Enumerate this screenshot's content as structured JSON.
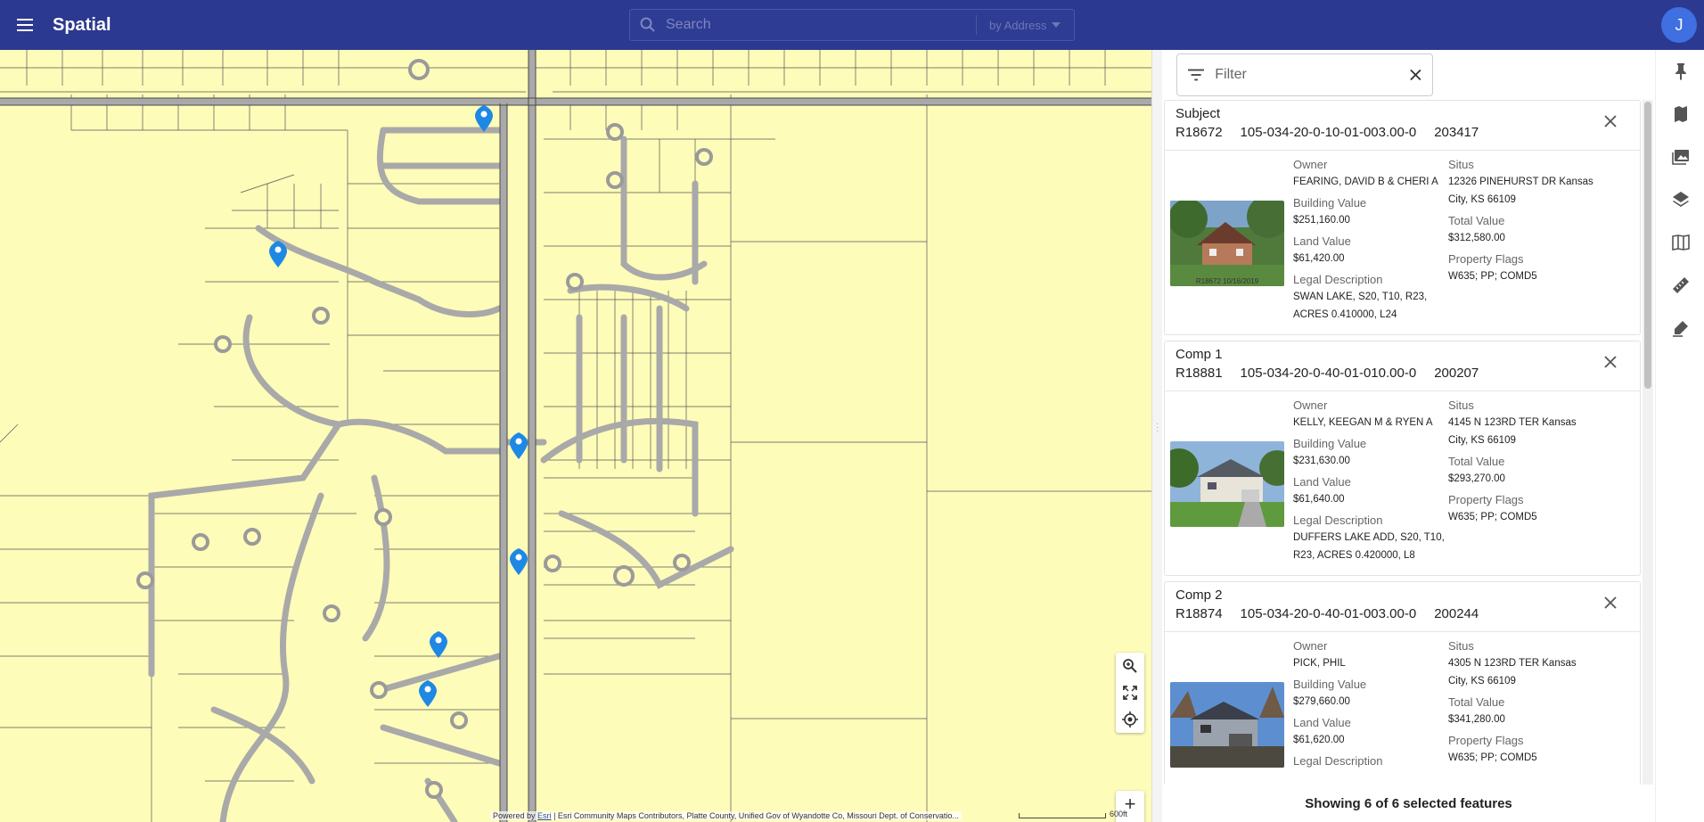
{
  "app": {
    "title": "Spatial",
    "user_initial": "J"
  },
  "search": {
    "placeholder": "Search",
    "mode": "by Address"
  },
  "filter": {
    "placeholder": "Filter"
  },
  "labels": {
    "owner": "Owner",
    "situs": "Situs",
    "building_value": "Building Value",
    "total_value": "Total Value",
    "land_value": "Land Value",
    "property_flags": "Property Flags",
    "legal_description": "Legal Description"
  },
  "cards": [
    {
      "title": "Subject",
      "parcel": "R18672",
      "pin": "105-034-20-0-10-01-003.00-0",
      "num": "203417",
      "owner": "FEARING, DAVID B & CHERI A",
      "situs_line1": "12326 PINEHURST DR Kansas",
      "situs_line2": "City, KS 66109",
      "building_value": "$251,160.00",
      "total_value": "$312,580.00",
      "land_value": "$61,420.00",
      "property_flags": "W635; PP; COMD5",
      "legal_line1": "SWAN LAKE, S20, T10, R23,",
      "legal_line2": "ACRES 0.410000, L24",
      "photo_caption": "R18672 10/16/2019"
    },
    {
      "title": "Comp 1",
      "parcel": "R18881",
      "pin": "105-034-20-0-40-01-010.00-0",
      "num": "200207",
      "owner": "KELLY, KEEGAN M & RYEN A",
      "situs_line1": "4145 N 123RD TER Kansas",
      "situs_line2": "City, KS 66109",
      "building_value": "$231,630.00",
      "total_value": "$293,270.00",
      "land_value": "$61,640.00",
      "property_flags": "W635; PP; COMD5",
      "legal_line1": "DUFFERS LAKE ADD, S20, T10,",
      "legal_line2": "R23, ACRES 0.420000, L8",
      "photo_caption": ""
    },
    {
      "title": "Comp 2",
      "parcel": "R18874",
      "pin": "105-034-20-0-40-01-003.00-0",
      "num": "200244",
      "owner": "PICK, PHIL",
      "situs_line1": "4305 N 123RD TER Kansas",
      "situs_line2": "City, KS 66109",
      "building_value": "$279,660.00",
      "total_value": "$341,280.00",
      "land_value": "$61,620.00",
      "property_flags": "W635; PP; COMD5",
      "legal_line1": "",
      "legal_line2": "",
      "photo_caption": ""
    }
  ],
  "footer": {
    "status": "Showing 6 of 6 selected features"
  },
  "map": {
    "attribution_prefix": "Powered by",
    "attribution_link": "Esri",
    "attribution_text": "| Esri Community Maps Contributors, Platte County, Unified Gov of Wyandotte Co, Missouri Dept. of Conservatio...",
    "scale_label": "600ft",
    "colors": {
      "parcel_fill": "#fefcb9",
      "road": "#9a9a9a",
      "marker": "#1e88e5",
      "topbar": "#2c3990"
    }
  },
  "icons": {
    "rail": [
      "pin-icon",
      "map-icon",
      "image-icon",
      "layers-icon",
      "book-map-icon",
      "ruler-icon",
      "draw-icon"
    ]
  }
}
